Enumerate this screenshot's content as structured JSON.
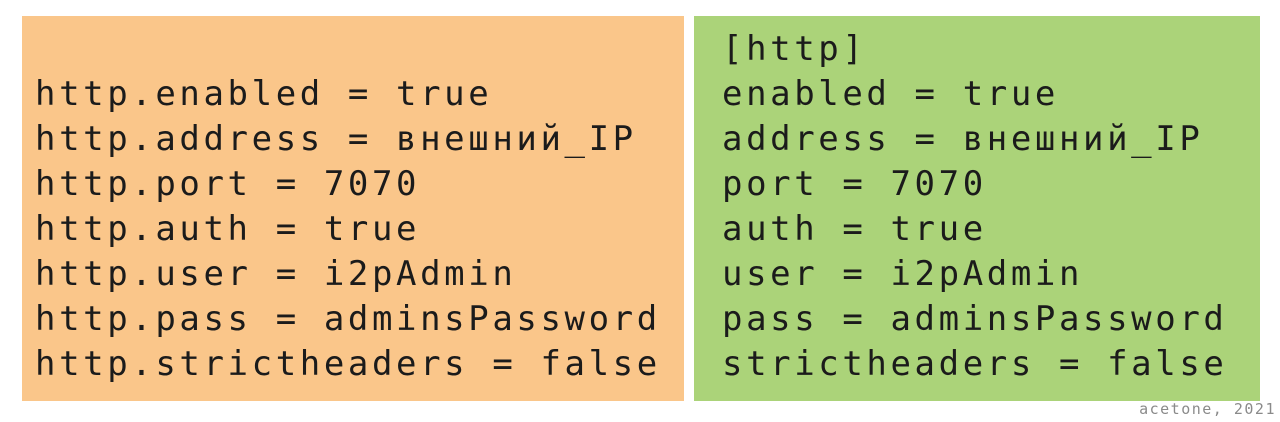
{
  "left_panel": {
    "lines": [
      "",
      "http.enabled = true",
      "http.address = внешний_IP",
      "http.port = 7070",
      "http.auth = true",
      "http.user = i2pAdmin",
      "http.pass = adminsPassword",
      "http.strictheaders = false"
    ],
    "background": "#fac68a"
  },
  "right_panel": {
    "lines": [
      "[http]",
      "enabled = true",
      "address = внешний_IP",
      "port = 7070",
      "auth = true",
      "user = i2pAdmin",
      "pass = adminsPassword",
      "strictheaders = false"
    ],
    "background": "#abd379"
  },
  "credit": "acetone, 2021"
}
